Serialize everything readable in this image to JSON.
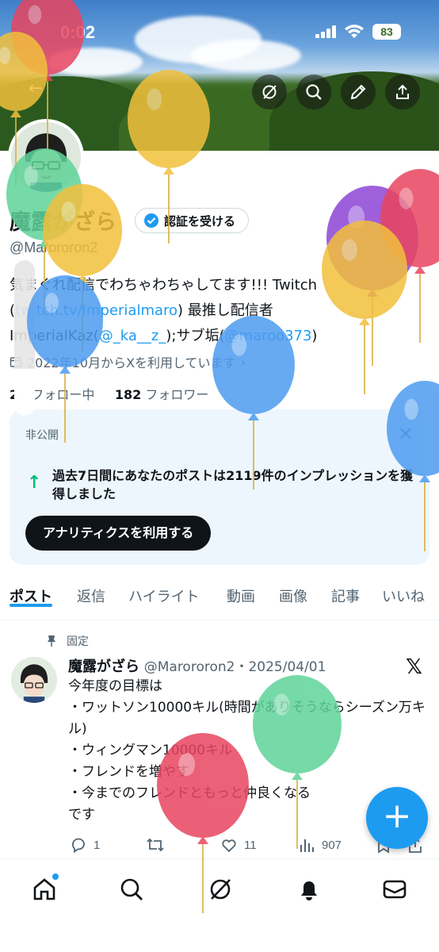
{
  "status_bar": {
    "time": "0:02",
    "battery": "83"
  },
  "header": {
    "back_label": "←",
    "icons": [
      "grok-icon",
      "search-icon",
      "edit-icon",
      "share-icon"
    ]
  },
  "profile": {
    "name": "魔露がざら",
    "verify_label": "認証を受ける",
    "handle": "@Marororon2",
    "bio_text_1": "気まぐれ配信でわちゃわちゃしてます!!! Twitch ",
    "bio_link_1": "twitch.tv/Imperialmaro",
    "bio_text_2": ") 最推し配信者",
    "bio_text_3": "ImperialKaz(",
    "bio_link_2": "@_ka__z_",
    "bio_text_4": ");サブ垢(",
    "bio_link_3": "@maroo373",
    "bio_text_5": ")",
    "joined": "2022年10月からXを利用しています",
    "following_count": "25",
    "following_label": "フォロー中",
    "followers_count": "182",
    "followers_label": "フォロワー"
  },
  "private_card": {
    "label": "非公開",
    "close": "×",
    "message": "過去7日間にあなたのポストは2119件のインプレッションを獲得しました",
    "cta": "アナリティクスを利用する"
  },
  "tabs": [
    "ポスト",
    "返信",
    "ハイライト",
    "動画",
    "画像",
    "記事",
    "いいね"
  ],
  "post": {
    "pinned_label": "固定",
    "author": "魔露がざら",
    "handle_date": "@Marororon2・2025/04/01",
    "lines": [
      "今年度の目標は",
      "・ワットソン10000キル(時間がありそうならシーズン万キル)",
      "・ウィングマン10000キル",
      "・フレンドを増やす",
      "・今までのフレンドともっと仲良くなる",
      "です"
    ],
    "replies": "1",
    "likes": "11",
    "views": "907"
  },
  "fab_label": "+",
  "volume_level": 0.3,
  "colors": {
    "accent": "#1d9bf0",
    "text": "#0f1419",
    "muted": "#536471",
    "card_bg": "#eef6fd"
  }
}
